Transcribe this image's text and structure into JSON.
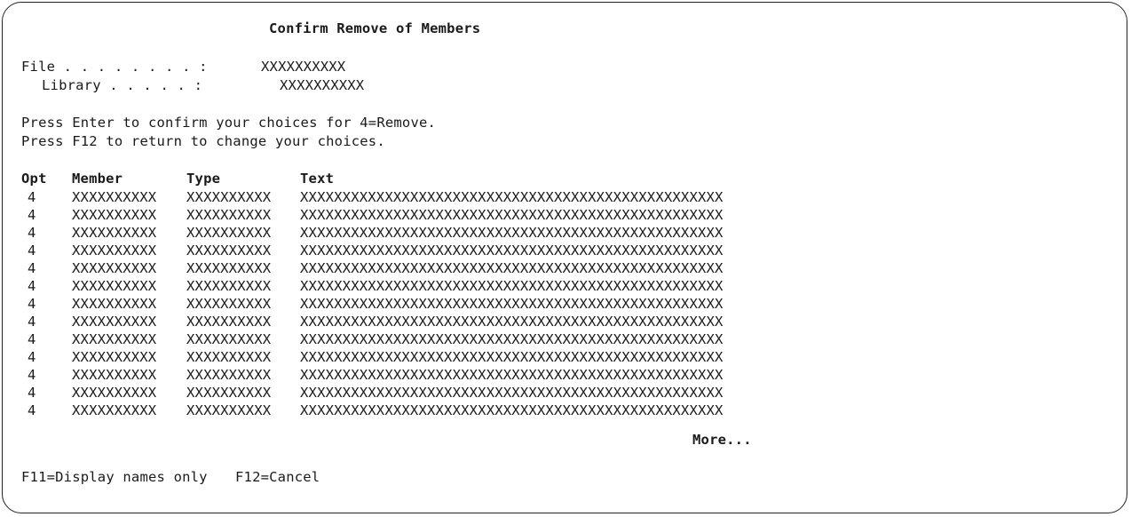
{
  "screen": {
    "title": "Confirm Remove of Members"
  },
  "fields": {
    "file_label": "File . . . . . . . . :",
    "file_value": "XXXXXXXXXX",
    "library_label": "Library . . . . . :",
    "library_value": "XXXXXXXXXX"
  },
  "instructions": [
    "Press Enter to confirm your choices for 4=Remove.",
    "Press F12 to return to change your choices."
  ],
  "table": {
    "headers": [
      "Opt",
      "Member",
      "Type",
      "Text"
    ],
    "rows": [
      {
        "opt": "4",
        "member": "XXXXXXXXXX",
        "type": "XXXXXXXXXX",
        "text": "XXXXXXXXXXXXXXXXXXXXXXXXXXXXXXXXXXXXXXXXXXXXXXXXXX"
      },
      {
        "opt": "4",
        "member": "XXXXXXXXXX",
        "type": "XXXXXXXXXX",
        "text": "XXXXXXXXXXXXXXXXXXXXXXXXXXXXXXXXXXXXXXXXXXXXXXXXXX"
      },
      {
        "opt": "4",
        "member": "XXXXXXXXXX",
        "type": "XXXXXXXXXX",
        "text": "XXXXXXXXXXXXXXXXXXXXXXXXXXXXXXXXXXXXXXXXXXXXXXXXXX"
      },
      {
        "opt": "4",
        "member": "XXXXXXXXXX",
        "type": "XXXXXXXXXX",
        "text": "XXXXXXXXXXXXXXXXXXXXXXXXXXXXXXXXXXXXXXXXXXXXXXXXXX"
      },
      {
        "opt": "4",
        "member": "XXXXXXXXXX",
        "type": "XXXXXXXXXX",
        "text": "XXXXXXXXXXXXXXXXXXXXXXXXXXXXXXXXXXXXXXXXXXXXXXXXXX"
      },
      {
        "opt": "4",
        "member": "XXXXXXXXXX",
        "type": "XXXXXXXXXX",
        "text": "XXXXXXXXXXXXXXXXXXXXXXXXXXXXXXXXXXXXXXXXXXXXXXXXXX"
      },
      {
        "opt": "4",
        "member": "XXXXXXXXXX",
        "type": "XXXXXXXXXX",
        "text": "XXXXXXXXXXXXXXXXXXXXXXXXXXXXXXXXXXXXXXXXXXXXXXXXXX"
      },
      {
        "opt": "4",
        "member": "XXXXXXXXXX",
        "type": "XXXXXXXXXX",
        "text": "XXXXXXXXXXXXXXXXXXXXXXXXXXXXXXXXXXXXXXXXXXXXXXXXXX"
      },
      {
        "opt": "4",
        "member": "XXXXXXXXXX",
        "type": "XXXXXXXXXX",
        "text": "XXXXXXXXXXXXXXXXXXXXXXXXXXXXXXXXXXXXXXXXXXXXXXXXXX"
      },
      {
        "opt": "4",
        "member": "XXXXXXXXXX",
        "type": "XXXXXXXXXX",
        "text": "XXXXXXXXXXXXXXXXXXXXXXXXXXXXXXXXXXXXXXXXXXXXXXXXXX"
      },
      {
        "opt": "4",
        "member": "XXXXXXXXXX",
        "type": "XXXXXXXXXX",
        "text": "XXXXXXXXXXXXXXXXXXXXXXXXXXXXXXXXXXXXXXXXXXXXXXXXXX"
      },
      {
        "opt": "4",
        "member": "XXXXXXXXXX",
        "type": "XXXXXXXXXX",
        "text": "XXXXXXXXXXXXXXXXXXXXXXXXXXXXXXXXXXXXXXXXXXXXXXXXXX"
      },
      {
        "opt": "4",
        "member": "XXXXXXXXXX",
        "type": "XXXXXXXXXX",
        "text": "XXXXXXXXXXXXXXXXXXXXXXXXXXXXXXXXXXXXXXXXXXXXXXXXXX"
      }
    ],
    "more_indicator": "More..."
  },
  "function_keys": [
    {
      "label": "F11=Display names only"
    },
    {
      "label": "F12=Cancel"
    }
  ]
}
